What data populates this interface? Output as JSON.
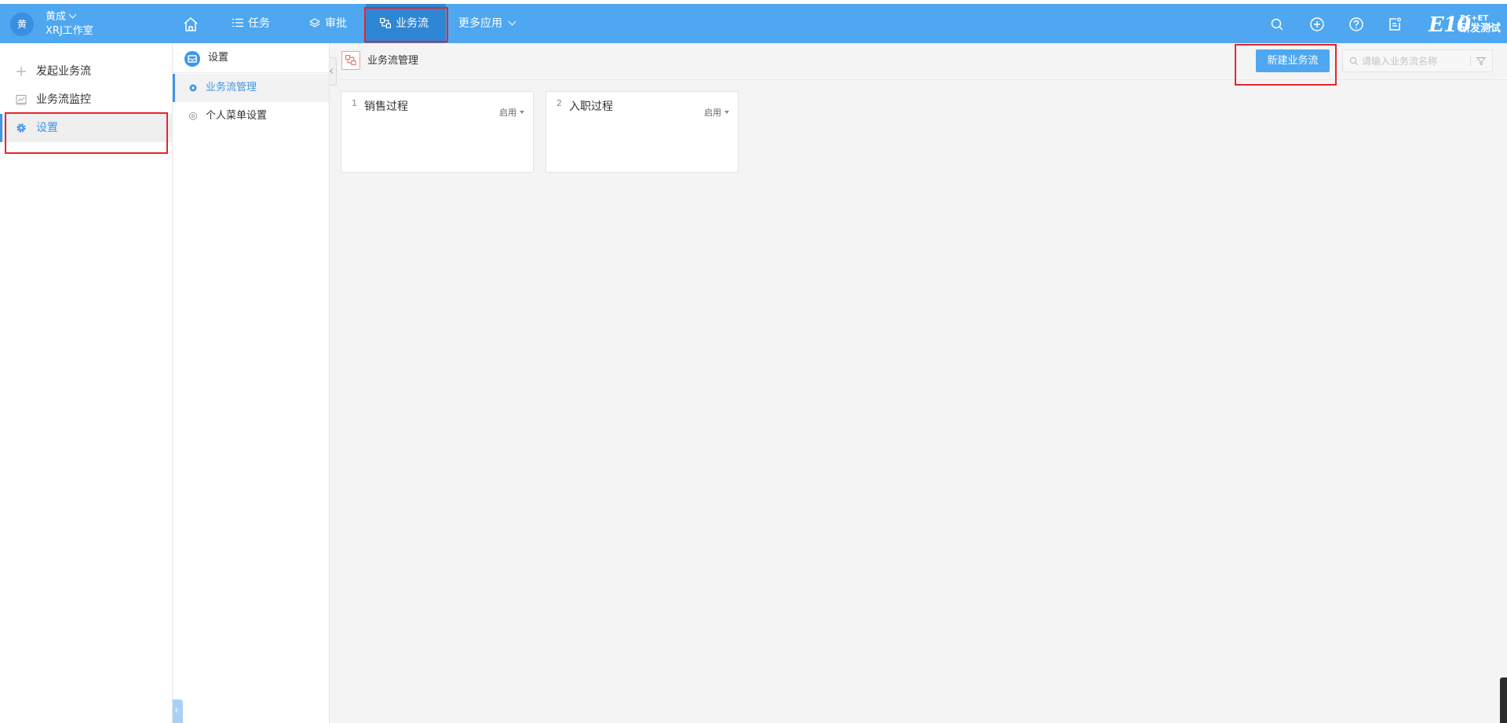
{
  "header": {
    "avatar_text": "黄",
    "user_name": "黄成",
    "org_name": "XRJ工作室",
    "nav": {
      "tasks": "任务",
      "approval": "审批",
      "workflow": "业务流",
      "more_apps": "更多应用"
    },
    "logo": {
      "main": "E10",
      "sup": "EC+ET",
      "sub": "研发测试"
    },
    "icons": [
      "home-icon",
      "list-icon",
      "layers-icon",
      "workflow-icon",
      "search-icon",
      "add-circle-icon",
      "help-icon",
      "notes-icon"
    ]
  },
  "sidebar": {
    "items": [
      {
        "label": "发起业务流",
        "icon": "plus-icon"
      },
      {
        "label": "业务流监控",
        "icon": "monitor-icon"
      },
      {
        "label": "设置",
        "icon": "gear-icon",
        "active": true
      }
    ]
  },
  "submenu": {
    "title": "设置",
    "items": [
      {
        "label": "业务流管理",
        "active": true
      },
      {
        "label": "个人菜单设置"
      }
    ]
  },
  "main": {
    "title": "业务流管理",
    "new_button": "新建业务流",
    "search_placeholder": "请输入业务流名称",
    "cards": [
      {
        "no": "1",
        "title": "销售过程",
        "status": "启用"
      },
      {
        "no": "2",
        "title": "入职过程",
        "status": "启用"
      }
    ]
  },
  "colors": {
    "header_bg": "#4ea7f0",
    "header_active": "#2f86d4",
    "accent": "#3f97e7",
    "highlight_box": "#e3262e",
    "page_bg": "#f4f4f4"
  }
}
